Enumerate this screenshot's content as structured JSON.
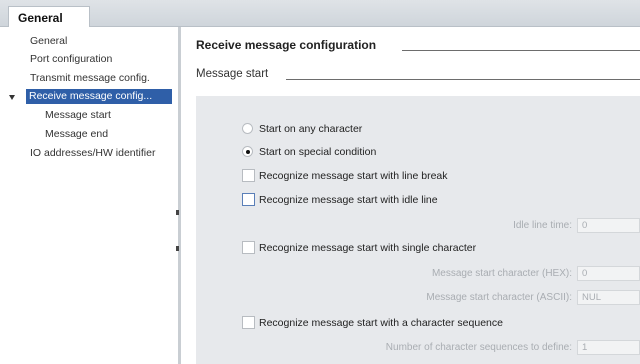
{
  "tabs": {
    "active_label": "General"
  },
  "nav": {
    "items": [
      {
        "label": "General"
      },
      {
        "label": "Port configuration"
      },
      {
        "label": "Transmit message config."
      },
      {
        "label": "Receive message config..."
      },
      {
        "label": "Message start"
      },
      {
        "label": "Message end"
      },
      {
        "label": "IO addresses/HW identifier"
      }
    ],
    "selected_index": 3
  },
  "main": {
    "section_title": "Receive message configuration",
    "subsection_title": "Message start",
    "options": {
      "start_any": {
        "label": "Start on any character",
        "checked": false
      },
      "start_special": {
        "label": "Start on special condition",
        "checked": true
      },
      "line_break": {
        "label": "Recognize message start with line break",
        "checked": false
      },
      "idle_line": {
        "label": "Recognize message start with idle line",
        "checked": false
      },
      "single_char": {
        "label": "Recognize message start with single character",
        "checked": false
      },
      "char_sequence": {
        "label": "Recognize message start with a character sequence",
        "checked": false
      }
    },
    "fields": {
      "idle_line_time": {
        "label": "Idle line time:",
        "value": "0"
      },
      "start_char_hex": {
        "label": "Message start character (HEX):",
        "value": "0"
      },
      "start_char_ascii": {
        "label": "Message start character (ASCII):",
        "value": "NUL"
      },
      "num_sequences": {
        "label": "Number of character sequences to define:",
        "value": "1"
      }
    }
  },
  "colors": {
    "selection": "#2f5fa8",
    "panel": "#e7e9ec",
    "tabstrip": "#d6dbe0"
  }
}
